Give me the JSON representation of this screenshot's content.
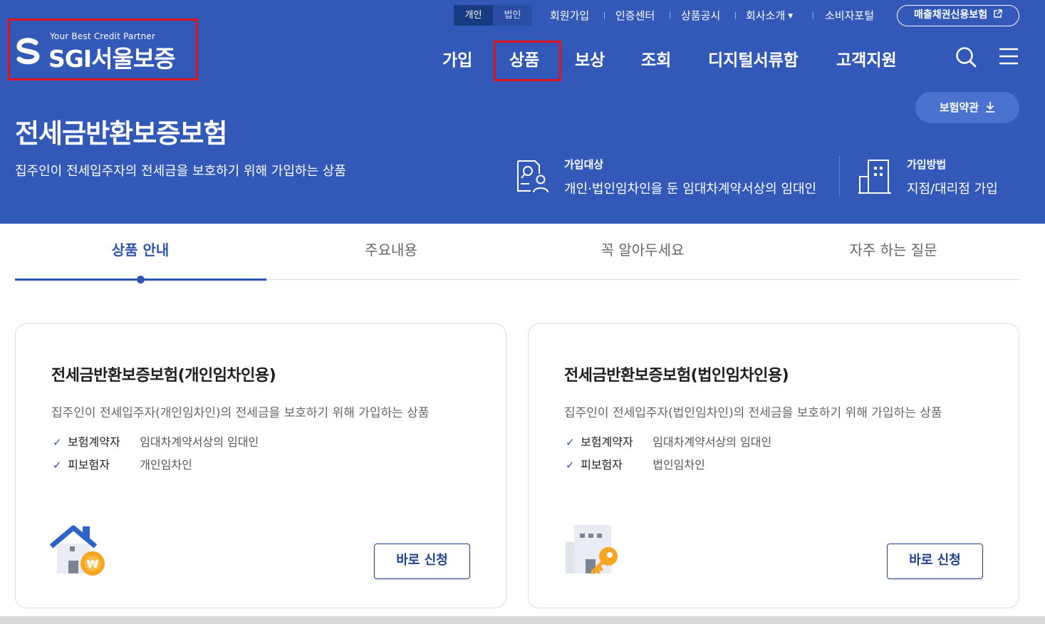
{
  "brand": {
    "tagline": "Your Best Credit Partner",
    "name": "SGI서울보증",
    "colors": {
      "primary": "#3259b8",
      "highlight": "#e0121b",
      "accent": "#2e55b0"
    }
  },
  "header": {
    "customer_toggle": {
      "personal": "개인",
      "corporate": "법인",
      "selected": "개인"
    },
    "util_links": [
      "회원가입",
      "인증센터",
      "상품공시",
      "회사소개",
      "소비자포털"
    ],
    "sales_credit_button": "매출채권신용보험",
    "gnb": [
      "가입",
      "상품",
      "보상",
      "조회",
      "디지털서류함",
      "고객지원"
    ],
    "icons": {
      "search": "search-icon",
      "menu": "hamburger-menu-icon",
      "external": "external-link-icon",
      "download": "download-icon"
    }
  },
  "hero": {
    "title": "전세금반환보증보험",
    "description": "집주인이 전세입주자의 전세금을 보호하기 위해 가입하는 상품",
    "terms_button": "보험약관",
    "target": {
      "label": "가입대상",
      "value": "개인·법인임차인을 둔 임대차계약서상의 임대인"
    },
    "method": {
      "label": "가입방법",
      "value": "지점/대리점 가입"
    }
  },
  "tabs": [
    "상품 안내",
    "주요내용",
    "꼭 알아두세요",
    "자주 하는 질문"
  ],
  "active_tab": "상품 안내",
  "cards": [
    {
      "title": "전세금반환보증보험(개인임차인용)",
      "description": "집주인이 전세입주자(개인임차인)의 전세금을 보호하기 위해 가입하는 상품",
      "rows": [
        {
          "label": "보험계약자",
          "value": "임대차계약서상의 임대인"
        },
        {
          "label": "피보험자",
          "value": "개인임차인"
        }
      ],
      "button": "바로 신청",
      "icon": "house-won-icon"
    },
    {
      "title": "전세금반환보증보험(법인임차인용)",
      "description": "집주인이 전세입주자(법인임차인)의 전세금을 보호하기 위해 가입하는 상품",
      "rows": [
        {
          "label": "보험계약자",
          "value": "임대차계약서상의 임대인"
        },
        {
          "label": "피보험자",
          "value": "법인임차인"
        }
      ],
      "button": "바로 신청",
      "icon": "building-key-icon"
    }
  ]
}
